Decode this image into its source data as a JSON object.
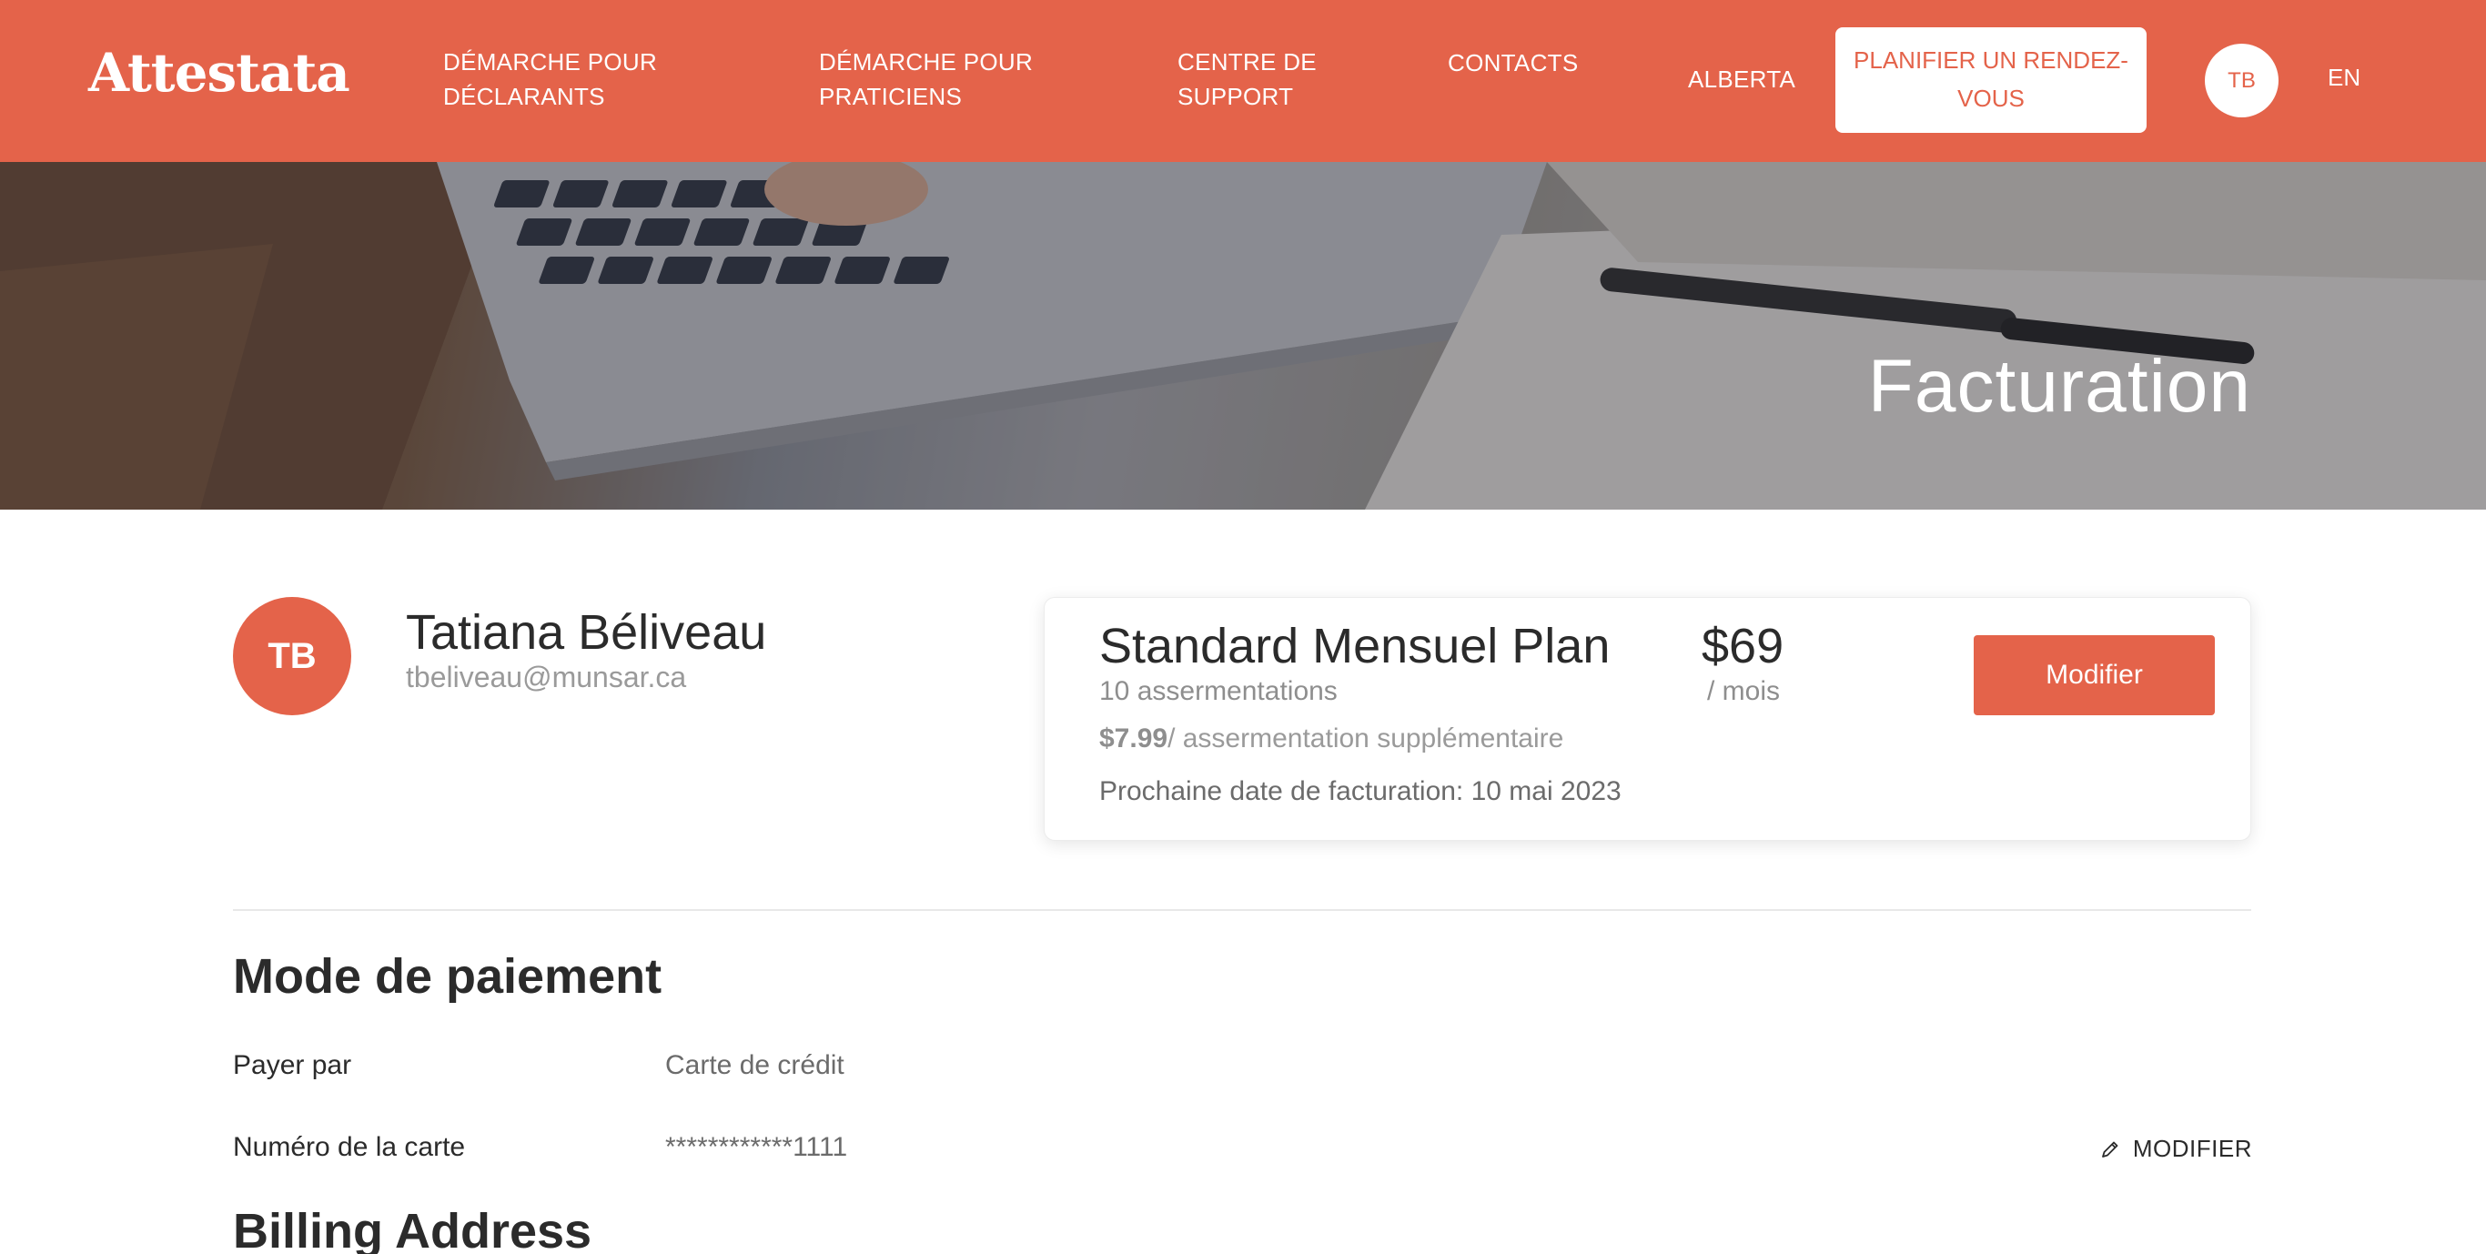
{
  "header": {
    "logo": "Attestata",
    "nav": {
      "declarants": "DÉMARCHE POUR DÉCLARANTS",
      "praticiens": "DÉMARCHE POUR PRATICIENS",
      "support": "CENTRE DE SUPPORT",
      "contacts": "CONTACTS",
      "province": "ALBERTA"
    },
    "cta": "PLANIFIER UN RENDEZ-VOUS",
    "user_initials": "TB",
    "language": "EN"
  },
  "hero": {
    "title": "Facturation"
  },
  "profile": {
    "initials": "TB",
    "name": "Tatiana Béliveau",
    "email": "tbeliveau@munsar.ca"
  },
  "plan": {
    "name": "Standard Mensuel Plan",
    "quota": "10 assermentations",
    "extra_price": "$7.99",
    "extra_label": "/ assermentation supplémentaire",
    "next_billing": "Prochaine date de facturation: 10 mai 2023",
    "price": "$69",
    "period": "/ mois",
    "modify_label": "Modifier"
  },
  "payment": {
    "title": "Mode de paiement",
    "pay_by_label": "Payer par",
    "pay_by_value": "Carte de crédit",
    "card_label": "Numéro de la carte",
    "card_value": "************1111",
    "modify_label": "MODIFIER",
    "modify_icon": "pencil-icon"
  },
  "billing": {
    "title": "Billing Address"
  },
  "colors": {
    "accent": "#e4634a",
    "text": "#2b2b2b",
    "muted": "#9a9a9a"
  }
}
